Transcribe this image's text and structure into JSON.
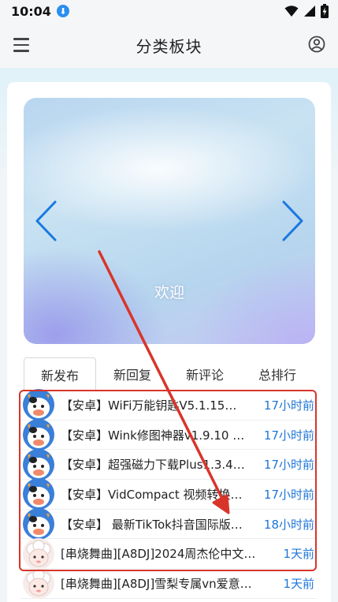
{
  "status_bar": {
    "time": "10:04"
  },
  "app_bar": {
    "title": "分类板块"
  },
  "banner": {
    "text": "欢迎"
  },
  "tabs": [
    {
      "label": "新发布",
      "active": true
    },
    {
      "label": "新回复",
      "active": false
    },
    {
      "label": "新评论",
      "active": false
    },
    {
      "label": "总排行",
      "active": false
    }
  ],
  "posts": [
    {
      "title": "【安卓】WiFi万能钥匙V5.1.15…",
      "time": "17小时前",
      "avatar": "cow-avatar"
    },
    {
      "title": "【安卓】Wink修图神器v1.9.10 …",
      "time": "17小时前",
      "avatar": "cow-avatar"
    },
    {
      "title": "【安卓】超强磁力下载Plus1.3.4…",
      "time": "17小时前",
      "avatar": "cow-avatar"
    },
    {
      "title": "【安卓】VidCompact 视频转换…",
      "time": "17小时前",
      "avatar": "cow-avatar"
    },
    {
      "title": "【安卓】 最新TikTok抖音国际版…",
      "time": "18小时前",
      "avatar": "cow-avatar"
    },
    {
      "title": "[串烧舞曲][A8DJ]2024周杰伦中文…",
      "time": "1天前",
      "avatar": "sheep-avatar"
    },
    {
      "title": "[串烧舞曲][A8DJ]雪梨专属vn爱意…",
      "time": "1天前",
      "avatar": "sheep-avatar"
    }
  ],
  "colors": {
    "accent": "#1e76d8",
    "annotation": "#d8352a",
    "download_badge": "#2a8ef0"
  }
}
